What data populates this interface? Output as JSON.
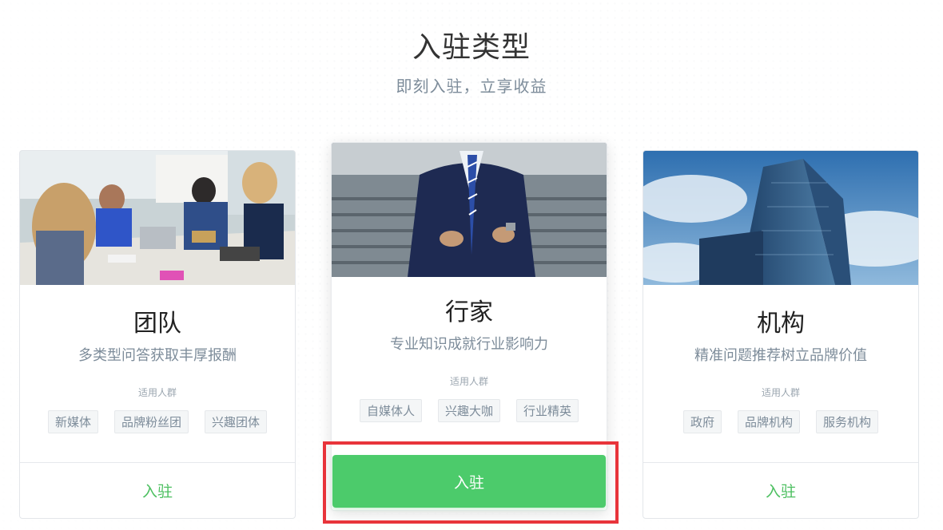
{
  "header": {
    "title": "入驻类型",
    "subtitle": "即刻入驻，立享收益"
  },
  "cards": [
    {
      "title": "团队",
      "subtitle": "多类型问答获取丰厚报酬",
      "audience_label": "适用人群",
      "tags": [
        "新媒体",
        "品牌粉丝团",
        "兴趣团体"
      ],
      "join_label": "入驻"
    },
    {
      "title": "行家",
      "subtitle": "专业知识成就行业影响力",
      "audience_label": "适用人群",
      "tags": [
        "自媒体人",
        "兴趣大咖",
        "行业精英"
      ],
      "join_label": "入驻"
    },
    {
      "title": "机构",
      "subtitle": "精准问题推荐树立品牌价值",
      "audience_label": "适用人群",
      "tags": [
        "政府",
        "品牌机构",
        "服务机构"
      ],
      "join_label": "入驻"
    }
  ],
  "colors": {
    "accent_green": "#4ccb6b",
    "link_green": "#4bbf5f",
    "highlight_red": "#e8343b",
    "muted_text": "#7d8c9a"
  }
}
